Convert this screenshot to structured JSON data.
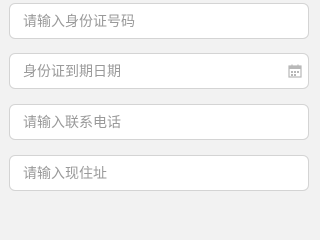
{
  "form": {
    "fields": [
      {
        "placeholder": "请输入身份证号码"
      },
      {
        "placeholder": "身份证到期日期",
        "icon": "calendar-icon"
      },
      {
        "placeholder": "请输入联系电话"
      },
      {
        "placeholder": "请输入现住址"
      }
    ]
  },
  "colors": {
    "page_background": "#f2f2f2",
    "field_background": "#ffffff",
    "field_border": "#d4d4d4",
    "placeholder_text": "#9a9a9a",
    "icon": "#b8b8b8"
  }
}
